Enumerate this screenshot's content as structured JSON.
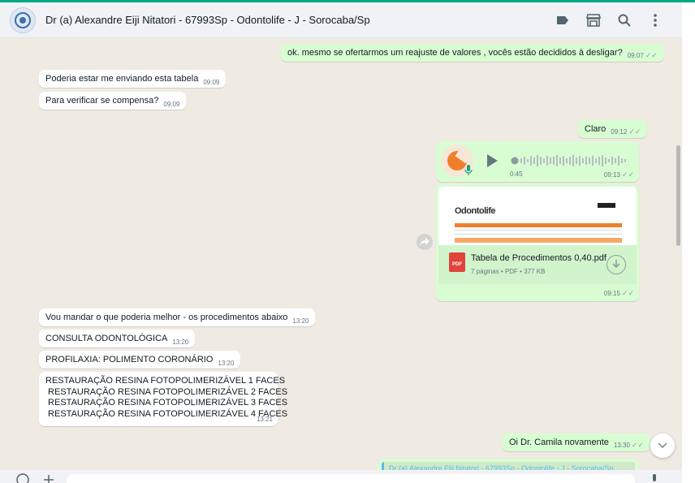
{
  "header": {
    "contact_name": "Dr (a) Alexandre Eiji Nitatori - 67993Sp - Odontolife - J - Sorocaba/Sp",
    "icons": [
      "label-icon",
      "store-icon",
      "search-icon",
      "menu-icon"
    ]
  },
  "messages": [
    {
      "dir": "out",
      "text": "ok. mesmo se ofertarmos um reajuste de valores , vocês estão decididos à desligar?",
      "time": "09:07"
    },
    {
      "dir": "in",
      "text": "Poderia estar me enviando esta tabela",
      "time": "09:09"
    },
    {
      "dir": "in",
      "text": "Para verificar se compensa?",
      "time": "09:09"
    },
    {
      "dir": "out",
      "text": "Claro",
      "time": "09:12"
    },
    {
      "dir": "in",
      "text": "Vou mandar o que poderia melhor - os procedimentos abaixo",
      "time": "13:20"
    },
    {
      "dir": "in",
      "text": "CONSULTA ODONTOLÓGICA",
      "time": "13:20"
    },
    {
      "dir": "in",
      "text": "PROFILAXIA: POLIMENTO CORONÁRIO",
      "time": "13:20"
    },
    {
      "dir": "in",
      "text": "RESTAURAÇÃO RESINA FOTOPOLIMERIZÁVEL 1 FACES\n RESTAURAÇÃO RESINA FOTOPOLIMERIZÁVEL 2 FACES\n RESTAURAÇÃO RESINA FOTOPOLIMERIZÁVEL 3 FACES\n RESTAURAÇÃO RESINA FOTOPOLIMERIZÁVEL 4 FACES",
      "time": "13:21"
    },
    {
      "dir": "out",
      "text": "Oi Dr. Camila novamente",
      "time": "13:30"
    }
  ],
  "audio": {
    "duration": "0:45",
    "time": "09:13",
    "progress": 0
  },
  "document": {
    "preview_logo": "Odontolife",
    "file_name": "Tabela de Procedimentos 0,40.pdf",
    "details": "7 páginas • PDF • 377 KB",
    "icon_label": "PDF",
    "time": "09:15"
  },
  "quoted": {
    "text": "Dr (a) Alexandre Eiji Nitatori - 67993Sp - Odontolife - J - Sorocaba/Sp"
  },
  "colors": {
    "accent": "#00a884",
    "outgoing": "#d9fdd3",
    "incoming": "#ffffff",
    "background": "#efeae2"
  }
}
